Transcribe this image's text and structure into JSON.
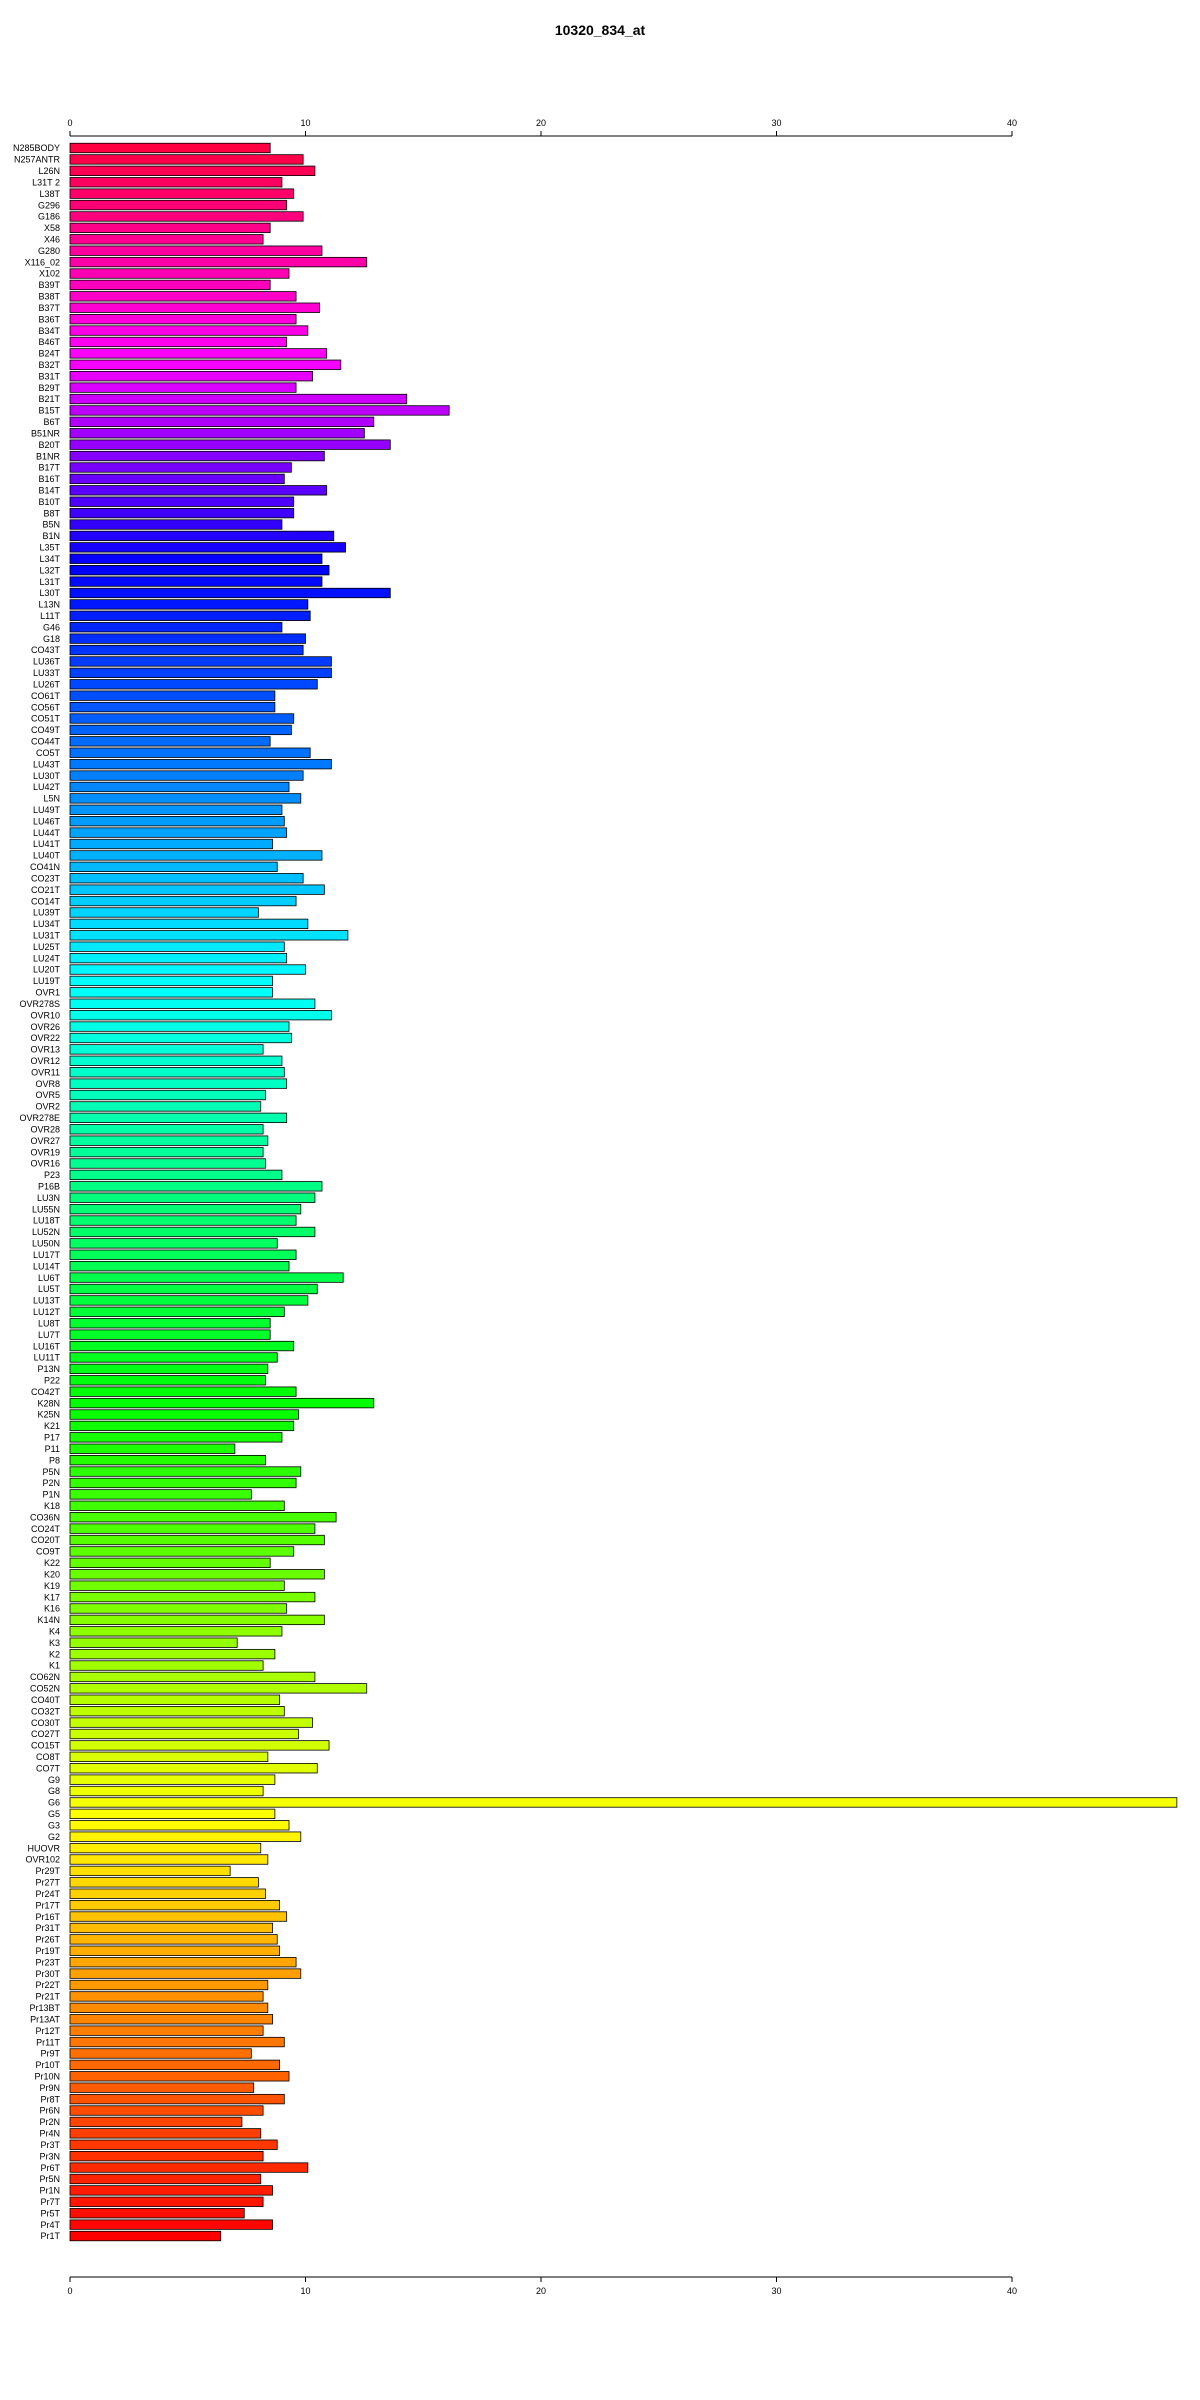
{
  "chart_data": {
    "type": "bar",
    "orientation": "horizontal",
    "title": "10320_834_at",
    "xlabel": "",
    "ylabel": "",
    "xlim": [
      0,
      47
    ],
    "xticks": [
      0,
      10,
      20,
      30,
      40
    ],
    "grid": false,
    "legend": "none",
    "colors": "rainbow",
    "categories": [
      "N285BODY",
      "N257ANTR",
      "L26N",
      "L31T 2",
      "L38T",
      "G296",
      "G186",
      "X58",
      "X46",
      "G280",
      "X116_02",
      "X102",
      "B39T",
      "B38T",
      "B37T",
      "B36T",
      "B34T",
      "B46T",
      "B24T",
      "B32T",
      "B31T",
      "B29T",
      "B21T",
      "B15T",
      "B6T",
      "B51NR",
      "B20T",
      "B1NR",
      "B17T",
      "B16T",
      "B14T",
      "B10T",
      "B8T",
      "B5N",
      "B1N",
      "L35T",
      "L34T",
      "L32T",
      "L31T",
      "L30T",
      "L13N",
      "L11T",
      "G46",
      "G18",
      "CO43T",
      "LU36T",
      "LU33T",
      "LU26T",
      "CO61T",
      "CO56T",
      "CO51T",
      "CO49T",
      "CO44T",
      "CO5T",
      "LU43T",
      "LU30T",
      "LU42T",
      "L5N",
      "LU49T",
      "LU46T",
      "LU44T",
      "LU41T",
      "LU40T",
      "CO41N",
      "CO23T",
      "CO21T",
      "CO14T",
      "LU39T",
      "LU34T",
      "LU31T",
      "LU25T",
      "LU24T",
      "LU20T",
      "LU19T",
      "OVR1",
      "OVR278S",
      "OVR10",
      "OVR26",
      "OVR22",
      "OVR13",
      "OVR12",
      "OVR11",
      "OVR8",
      "OVR5",
      "OVR2",
      "OVR278E",
      "OVR28",
      "OVR27",
      "OVR19",
      "OVR16",
      "P23",
      "P16B",
      "LU3N",
      "LU55N",
      "LU18T",
      "LU52N",
      "LU50N",
      "LU17T",
      "LU14T",
      "LU6T",
      "LU5T",
      "LU13T",
      "LU12T",
      "LU8T",
      "LU7T",
      "LU16T",
      "LU11T",
      "P13N",
      "P22",
      "CO42T",
      "K28N",
      "K25N",
      "K21",
      "P17",
      "P11",
      "P8",
      "P5N",
      "P2N",
      "P1N",
      "K18",
      "CO36N",
      "CO24T",
      "CO20T",
      "CO9T",
      "K22",
      "K20",
      "K19",
      "K17",
      "K16",
      "K14N",
      "K4",
      "K3",
      "K2",
      "K1",
      "CO62N",
      "CO52N",
      "CO40T",
      "CO32T",
      "CO30T",
      "CO27T",
      "CO15T",
      "CO8T",
      "CO7T",
      "G9",
      "G8",
      "G6",
      "G5",
      "G3",
      "G2",
      "HUOVR",
      "OVR102",
      "Pr29T",
      "Pr27T",
      "Pr24T",
      "Pr17T",
      "Pr16T",
      "Pr31T",
      "Pr26T",
      "Pr19T",
      "Pr23T",
      "Pr30T",
      "Pr22T",
      "Pr21T",
      "Pr13BT",
      "Pr13AT",
      "Pr12T",
      "Pr11T",
      "Pr9T",
      "Pr10T",
      "Pr10N",
      "Pr9N",
      "Pr8T",
      "Pr6N",
      "Pr2N",
      "Pr4N",
      "Pr3T",
      "Pr3N",
      "Pr6T",
      "Pr5N",
      "Pr1N",
      "Pr7T",
      "Pr5T",
      "Pr4T",
      "Pr1T"
    ],
    "values": [
      8.5,
      9.9,
      10.4,
      9.0,
      9.5,
      9.2,
      9.9,
      8.5,
      8.2,
      10.7,
      12.6,
      9.3,
      8.5,
      9.6,
      10.6,
      9.6,
      10.1,
      9.2,
      10.9,
      11.5,
      10.3,
      9.6,
      14.3,
      16.1,
      12.9,
      12.5,
      13.6,
      10.8,
      9.4,
      9.1,
      10.9,
      9.5,
      9.5,
      9.0,
      11.2,
      11.7,
      10.7,
      11.0,
      10.7,
      13.6,
      10.1,
      10.2,
      9.0,
      10.0,
      9.9,
      11.1,
      11.1,
      10.5,
      8.7,
      8.7,
      9.5,
      9.4,
      8.5,
      10.2,
      11.1,
      9.9,
      9.3,
      9.8,
      9.0,
      9.1,
      9.2,
      8.6,
      10.7,
      8.8,
      9.9,
      10.8,
      9.6,
      8.0,
      10.1,
      11.8,
      9.1,
      9.2,
      10.0,
      8.6,
      8.6,
      10.4,
      11.1,
      9.3,
      9.4,
      8.2,
      9.0,
      9.1,
      9.2,
      8.3,
      8.1,
      9.2,
      8.2,
      8.4,
      8.2,
      8.3,
      9.0,
      10.7,
      10.4,
      9.8,
      9.6,
      10.4,
      8.8,
      9.6,
      9.3,
      11.6,
      10.5,
      10.1,
      9.1,
      8.5,
      8.5,
      9.5,
      8.8,
      8.4,
      8.3,
      9.6,
      12.9,
      9.7,
      9.5,
      9.0,
      7.0,
      8.3,
      9.8,
      9.6,
      7.7,
      9.1,
      11.3,
      10.4,
      10.8,
      9.5,
      8.5,
      10.8,
      9.1,
      10.4,
      9.2,
      10.8,
      9.0,
      7.1,
      8.7,
      8.2,
      10.4,
      12.6,
      8.9,
      9.1,
      10.3,
      9.7,
      11.0,
      8.4,
      10.5,
      8.7,
      8.2,
      47.0,
      8.7,
      9.3,
      9.8,
      8.1,
      8.4,
      6.8,
      8.0,
      8.3,
      8.9,
      9.2,
      8.6,
      8.8,
      8.9,
      9.6,
      9.8,
      8.4,
      8.2,
      8.4,
      8.6,
      8.2,
      9.1,
      7.7,
      8.9,
      9.3,
      7.8,
      9.1,
      8.2,
      7.3,
      8.1,
      8.8,
      8.2,
      10.1,
      8.1,
      8.6,
      8.2,
      7.4,
      8.6,
      6.4
    ]
  }
}
